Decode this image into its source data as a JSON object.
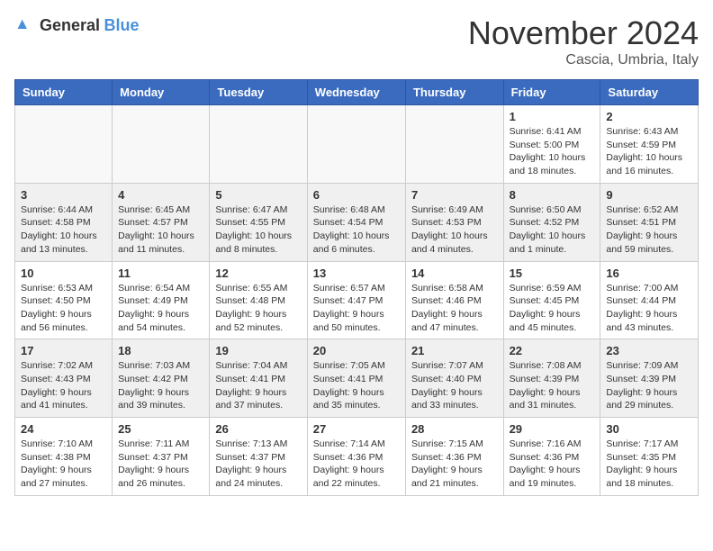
{
  "header": {
    "logo": {
      "general": "General",
      "blue": "Blue"
    },
    "title": "November 2024",
    "location": "Cascia, Umbria, Italy"
  },
  "calendar": {
    "weekdays": [
      "Sunday",
      "Monday",
      "Tuesday",
      "Wednesday",
      "Thursday",
      "Friday",
      "Saturday"
    ],
    "weeks": [
      [
        {
          "day": "",
          "info": ""
        },
        {
          "day": "",
          "info": ""
        },
        {
          "day": "",
          "info": ""
        },
        {
          "day": "",
          "info": ""
        },
        {
          "day": "",
          "info": ""
        },
        {
          "day": "1",
          "info": "Sunrise: 6:41 AM\nSunset: 5:00 PM\nDaylight: 10 hours\nand 18 minutes."
        },
        {
          "day": "2",
          "info": "Sunrise: 6:43 AM\nSunset: 4:59 PM\nDaylight: 10 hours\nand 16 minutes."
        }
      ],
      [
        {
          "day": "3",
          "info": "Sunrise: 6:44 AM\nSunset: 4:58 PM\nDaylight: 10 hours\nand 13 minutes."
        },
        {
          "day": "4",
          "info": "Sunrise: 6:45 AM\nSunset: 4:57 PM\nDaylight: 10 hours\nand 11 minutes."
        },
        {
          "day": "5",
          "info": "Sunrise: 6:47 AM\nSunset: 4:55 PM\nDaylight: 10 hours\nand 8 minutes."
        },
        {
          "day": "6",
          "info": "Sunrise: 6:48 AM\nSunset: 4:54 PM\nDaylight: 10 hours\nand 6 minutes."
        },
        {
          "day": "7",
          "info": "Sunrise: 6:49 AM\nSunset: 4:53 PM\nDaylight: 10 hours\nand 4 minutes."
        },
        {
          "day": "8",
          "info": "Sunrise: 6:50 AM\nSunset: 4:52 PM\nDaylight: 10 hours\nand 1 minute."
        },
        {
          "day": "9",
          "info": "Sunrise: 6:52 AM\nSunset: 4:51 PM\nDaylight: 9 hours\nand 59 minutes."
        }
      ],
      [
        {
          "day": "10",
          "info": "Sunrise: 6:53 AM\nSunset: 4:50 PM\nDaylight: 9 hours\nand 56 minutes."
        },
        {
          "day": "11",
          "info": "Sunrise: 6:54 AM\nSunset: 4:49 PM\nDaylight: 9 hours\nand 54 minutes."
        },
        {
          "day": "12",
          "info": "Sunrise: 6:55 AM\nSunset: 4:48 PM\nDaylight: 9 hours\nand 52 minutes."
        },
        {
          "day": "13",
          "info": "Sunrise: 6:57 AM\nSunset: 4:47 PM\nDaylight: 9 hours\nand 50 minutes."
        },
        {
          "day": "14",
          "info": "Sunrise: 6:58 AM\nSunset: 4:46 PM\nDaylight: 9 hours\nand 47 minutes."
        },
        {
          "day": "15",
          "info": "Sunrise: 6:59 AM\nSunset: 4:45 PM\nDaylight: 9 hours\nand 45 minutes."
        },
        {
          "day": "16",
          "info": "Sunrise: 7:00 AM\nSunset: 4:44 PM\nDaylight: 9 hours\nand 43 minutes."
        }
      ],
      [
        {
          "day": "17",
          "info": "Sunrise: 7:02 AM\nSunset: 4:43 PM\nDaylight: 9 hours\nand 41 minutes."
        },
        {
          "day": "18",
          "info": "Sunrise: 7:03 AM\nSunset: 4:42 PM\nDaylight: 9 hours\nand 39 minutes."
        },
        {
          "day": "19",
          "info": "Sunrise: 7:04 AM\nSunset: 4:41 PM\nDaylight: 9 hours\nand 37 minutes."
        },
        {
          "day": "20",
          "info": "Sunrise: 7:05 AM\nSunset: 4:41 PM\nDaylight: 9 hours\nand 35 minutes."
        },
        {
          "day": "21",
          "info": "Sunrise: 7:07 AM\nSunset: 4:40 PM\nDaylight: 9 hours\nand 33 minutes."
        },
        {
          "day": "22",
          "info": "Sunrise: 7:08 AM\nSunset: 4:39 PM\nDaylight: 9 hours\nand 31 minutes."
        },
        {
          "day": "23",
          "info": "Sunrise: 7:09 AM\nSunset: 4:39 PM\nDaylight: 9 hours\nand 29 minutes."
        }
      ],
      [
        {
          "day": "24",
          "info": "Sunrise: 7:10 AM\nSunset: 4:38 PM\nDaylight: 9 hours\nand 27 minutes."
        },
        {
          "day": "25",
          "info": "Sunrise: 7:11 AM\nSunset: 4:37 PM\nDaylight: 9 hours\nand 26 minutes."
        },
        {
          "day": "26",
          "info": "Sunrise: 7:13 AM\nSunset: 4:37 PM\nDaylight: 9 hours\nand 24 minutes."
        },
        {
          "day": "27",
          "info": "Sunrise: 7:14 AM\nSunset: 4:36 PM\nDaylight: 9 hours\nand 22 minutes."
        },
        {
          "day": "28",
          "info": "Sunrise: 7:15 AM\nSunset: 4:36 PM\nDaylight: 9 hours\nand 21 minutes."
        },
        {
          "day": "29",
          "info": "Sunrise: 7:16 AM\nSunset: 4:36 PM\nDaylight: 9 hours\nand 19 minutes."
        },
        {
          "day": "30",
          "info": "Sunrise: 7:17 AM\nSunset: 4:35 PM\nDaylight: 9 hours\nand 18 minutes."
        }
      ]
    ]
  }
}
